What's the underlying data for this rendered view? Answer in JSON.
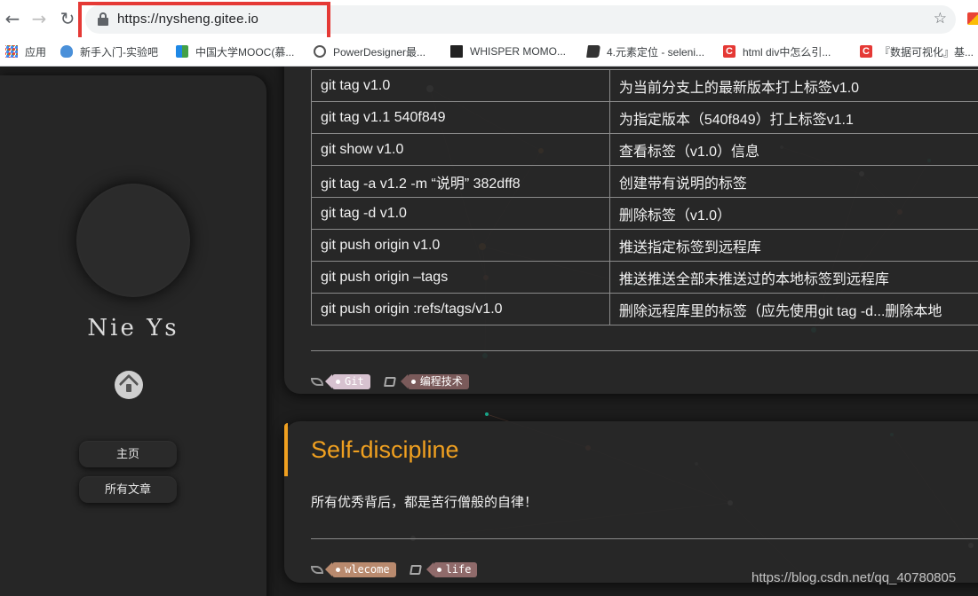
{
  "browser": {
    "url": "https://nysheng.gitee.io",
    "back_icon": "←",
    "forward_icon": "→",
    "reload_icon": "↻",
    "star_icon": "☆",
    "bookmarks": [
      {
        "label": "应用",
        "icon": "apps-icon"
      },
      {
        "label": "新手入门-实验吧",
        "icon": "cloud-icon"
      },
      {
        "label": "中国大学MOOC(慕...",
        "icon": "mooc-icon"
      },
      {
        "label": "PowerDesigner最...",
        "icon": "powerdesigner-icon"
      },
      {
        "label": "WHISPER MOMO...",
        "icon": "whisper-icon"
      },
      {
        "label": "4.元素定位 - seleni...",
        "icon": "book-icon"
      },
      {
        "label": "html div中怎么引...",
        "icon": "csdn-icon"
      },
      {
        "label": "『数据可视化』基...",
        "icon": "csdn-icon"
      }
    ]
  },
  "sidebar": {
    "author": "Nie Ys",
    "nav": {
      "home": "主页",
      "all_posts": "所有文章"
    }
  },
  "post1": {
    "rows": [
      [
        "git tag v1.0",
        "为当前分支上的最新版本打上标签v1.0"
      ],
      [
        "git tag v1.1 540f849",
        "为指定版本（540f849）打上标签v1.1"
      ],
      [
        "git show v1.0",
        "查看标签（v1.0）信息"
      ],
      [
        "git tag -a v1.2 -m “说明” 382dff8",
        "创建带有说明的标签"
      ],
      [
        "git tag -d v1.0",
        "删除标签（v1.0）"
      ],
      [
        "git push origin v1.0",
        "推送指定标签到远程库"
      ],
      [
        "git push origin –tags",
        "推送推送全部未推送过的本地标签到远程库"
      ],
      [
        "git push origin :refs/tags/v1.0",
        "删除远程库里的标签（应先使用git tag -d...删除本地"
      ]
    ],
    "tags": [
      "Git"
    ],
    "categories": [
      "编程技术"
    ]
  },
  "post2": {
    "title": "Self-discipline",
    "excerpt": "所有优秀背后，都是苦行僧般的自律！",
    "tags": [
      "wlecome"
    ],
    "categories": [
      "life"
    ]
  },
  "watermark": "https://blog.csdn.net/qq_40780805",
  "colors": {
    "accent": "#f0a020",
    "card_bg": "#282828",
    "highlight": "#e53935"
  }
}
